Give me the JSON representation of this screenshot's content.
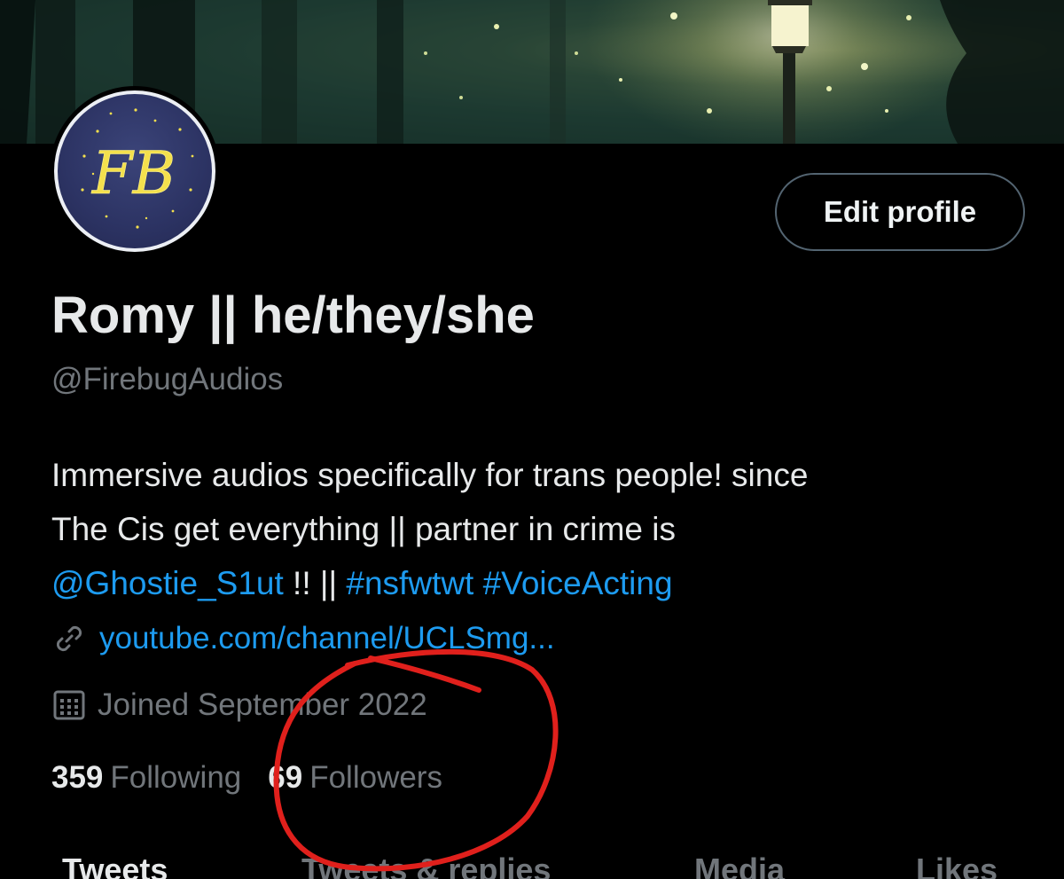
{
  "profile": {
    "avatar_monogram": "FB",
    "edit_label": "Edit profile",
    "display_name": "Romy || he/they/she",
    "handle": "@FirebugAudios",
    "bio": {
      "line1": "Immersive audios specifically for trans people! since",
      "line2": "The Cis get everything || partner in crime is",
      "mention": "@Ghostie_S1ut",
      "separator": " !! || ",
      "tag1": "#nsfwtwt",
      "tag2": "#VoiceActing"
    },
    "url": "youtube.com/channel/UCLSmg...",
    "joined": "Joined September 2022",
    "following_count": "359",
    "following_label": "Following",
    "followers_count": "69",
    "followers_label": "Followers"
  },
  "tabs": [
    {
      "label": "Tweets",
      "active": true
    },
    {
      "label": "Tweets & replies",
      "active": false
    },
    {
      "label": "Media",
      "active": false
    },
    {
      "label": "Likes",
      "active": false
    }
  ],
  "icons": {
    "link": "link-icon",
    "calendar": "calendar-icon"
  },
  "colors": {
    "background": "#000000",
    "link": "#1d9bf0",
    "secondary_text": "#71767b",
    "annotation": "#e0201c"
  }
}
